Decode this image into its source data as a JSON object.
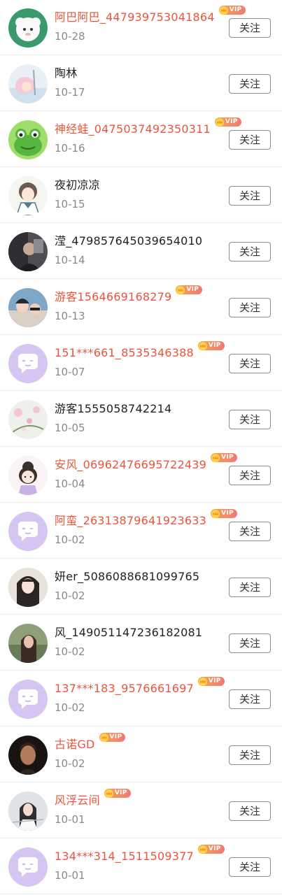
{
  "follow_label": "关注",
  "vip_label": "VIP",
  "colors": {
    "vip_name": "#e8553c",
    "normal_name": "#222222",
    "date": "#8a8a8a"
  },
  "users": [
    {
      "name": "阿巴阿巴_447939753041864",
      "date": "10-28",
      "vip": true,
      "avatar": "sheep-cartoon"
    },
    {
      "name": "陶林",
      "date": "10-17",
      "vip": false,
      "avatar": "anime-girl-pink"
    },
    {
      "name": "神经蛙_0475037492350311",
      "date": "10-16",
      "vip": true,
      "avatar": "green-frog"
    },
    {
      "name": "夜初凉凉",
      "date": "10-15",
      "vip": false,
      "avatar": "anime-girl-sailor"
    },
    {
      "name": "滢_479857645039654010",
      "date": "10-14",
      "vip": false,
      "avatar": "photo-dark"
    },
    {
      "name": "游客1564669168279",
      "date": "10-13",
      "vip": true,
      "avatar": "photo-couple"
    },
    {
      "name": "151***661_8535346388",
      "date": "10-07",
      "vip": true,
      "avatar": "default-chat"
    },
    {
      "name": "游客1555058742214",
      "date": "10-05",
      "vip": false,
      "avatar": "flowers"
    },
    {
      "name": "安风_06962476695722439",
      "date": "10-04",
      "vip": true,
      "avatar": "chibi-girl"
    },
    {
      "name": "阿蛮_26313879641923633",
      "date": "10-02",
      "vip": true,
      "avatar": "default-chat"
    },
    {
      "name": "妍er_5086088681099765",
      "date": "10-02",
      "vip": false,
      "avatar": "ancient-girl"
    },
    {
      "name": "风_149051147236182081",
      "date": "10-02",
      "vip": false,
      "avatar": "photo-woman"
    },
    {
      "name": "137***183_9576661697",
      "date": "10-02",
      "vip": true,
      "avatar": "default-chat"
    },
    {
      "name": "古诺GD",
      "date": "10-02",
      "vip": true,
      "avatar": "photo-man"
    },
    {
      "name": "风浮云间",
      "date": "10-01",
      "vip": true,
      "avatar": "ancient-man"
    },
    {
      "name": "134***314_1511509377",
      "date": "10-01",
      "vip": true,
      "avatar": "default-chat"
    }
  ]
}
